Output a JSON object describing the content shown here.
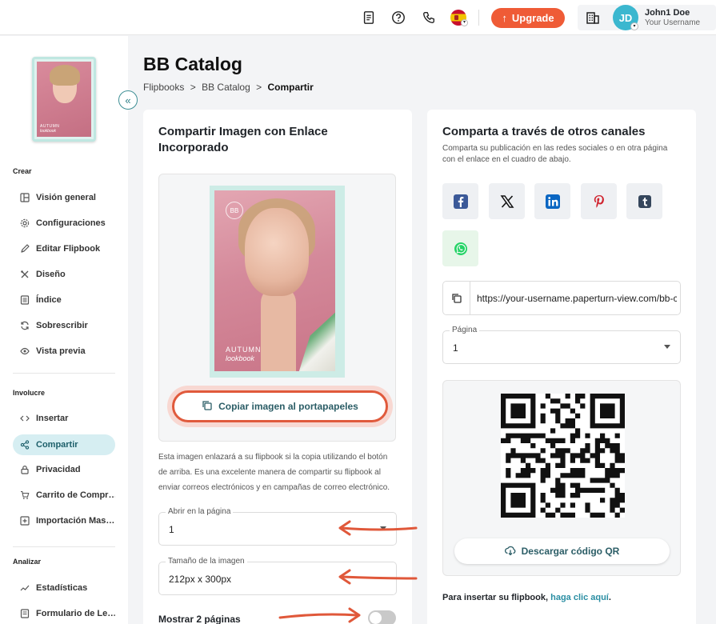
{
  "header": {
    "upgrade_label": "Upgrade",
    "avatar_initials": "JD",
    "user_name": "John1 Doe",
    "user_sub": "Your Username"
  },
  "sidebar": {
    "collapse_glyph": "«",
    "thumb": {
      "line1": "AUTUMN",
      "line2": "lookbook"
    },
    "sections": [
      {
        "label": "Crear"
      },
      {
        "label": "Involucre"
      },
      {
        "label": "Analizar"
      }
    ],
    "items": [
      {
        "label": "Visión general",
        "icon": "layout-icon"
      },
      {
        "label": "Configuraciones",
        "icon": "gear-icon"
      },
      {
        "label": "Editar Flipbook",
        "icon": "pencil-icon"
      },
      {
        "label": "Diseño",
        "icon": "design-icon"
      },
      {
        "label": "Índice",
        "icon": "list-icon"
      },
      {
        "label": "Sobrescribir",
        "icon": "refresh-icon"
      },
      {
        "label": "Vista previa",
        "icon": "eye-icon"
      },
      {
        "label": "Insertar",
        "icon": "code-icon"
      },
      {
        "label": "Compartir",
        "icon": "share-icon",
        "active": true
      },
      {
        "label": "Privacidad",
        "icon": "lock-icon"
      },
      {
        "label": "Carrito de Compr…",
        "icon": "cart-icon"
      },
      {
        "label": "Importación Mas…",
        "icon": "import-icon"
      },
      {
        "label": "Estadísticas",
        "icon": "chart-icon"
      },
      {
        "label": "Formulario de Le…",
        "icon": "form-icon"
      }
    ]
  },
  "main": {
    "title": "BB Catalog",
    "breadcrumb": {
      "item1": "Flipbooks",
      "item2": "BB Catalog",
      "current": "Compartir",
      "sep": ">"
    }
  },
  "left_card": {
    "title": "Compartir Imagen con Enlace Incorporado",
    "cover": {
      "logo": "BB",
      "autumn": "AUTUMN",
      "lookbook": "lookbook"
    },
    "copy_button": "Copiar imagen al portapapeles",
    "description": "Esta imagen enlazará a su flipbook si la copia utilizando el botón de arriba. Es una excelente manera de compartir su flipbook al enviar correos electrónicos y en campañas de correo electrónico.",
    "open_page": {
      "label": "Abrir en la página",
      "value": "1"
    },
    "image_size": {
      "label": "Tamaño de la imagen",
      "value": "212px x 300px"
    },
    "toggle_label": "Mostrar 2 páginas",
    "toggle_on": false
  },
  "right_card": {
    "title": "Comparta a través de otros canales",
    "subtitle": "Comparta su publicación en las redes sociales o en otra página con el enlace en el cuadro de abajo.",
    "socials": [
      "facebook-icon",
      "x-icon",
      "linkedin-icon",
      "pinterest-icon",
      "tumblr-icon",
      "whatsapp-icon"
    ],
    "url": "https://your-username.paperturn-view.com/bb-catalog",
    "page": {
      "label": "Página",
      "value": "1"
    },
    "qr_button": "Descargar código QR",
    "embed_text": "Para insertar su flipbook,",
    "embed_link": "haga clic aquí",
    "embed_end": "."
  },
  "colors": {
    "accent": "#ef5b36",
    "teal": "#2b5d66",
    "active_bg": "#d6eef2",
    "link": "#2a8ea3"
  }
}
